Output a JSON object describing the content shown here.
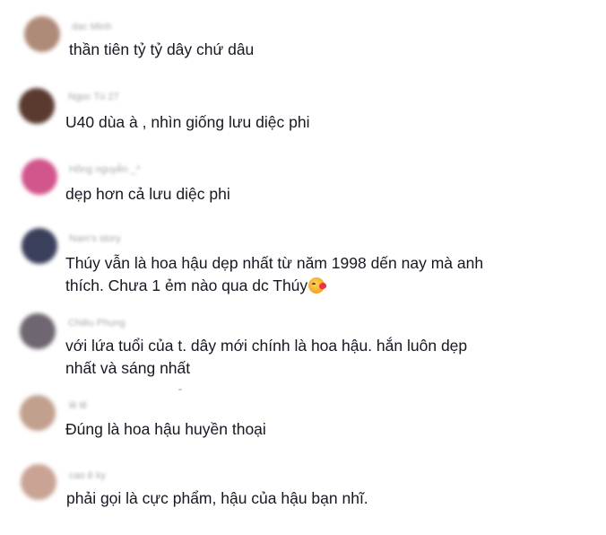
{
  "comments": [
    {
      "username": "dac Minh",
      "text": "thần tiên tỷ tỷ dây chứ dâu",
      "avatar_color": "#b08a78"
    },
    {
      "username": "Ngọc Tú 27",
      "text": "U40 dùa à , nhìn giống lưu diệc phi",
      "avatar_color": "#5a3a2e"
    },
    {
      "username": "Hồng nguyễn _^",
      "text": "dẹp hơn cả lưu diệc phi",
      "avatar_color": "#d2558c"
    },
    {
      "username": "Nam's story",
      "lines": [
        "Thúy vẫn là hoa hậu dẹp nhất từ năm 1998 dến nay mà anh",
        "thích. Chưa 1 ẻm nào qua dc Thúy"
      ],
      "emoji": "face-blowing-kiss-icon",
      "avatar_color": "#3a3f5c"
    },
    {
      "username": "Chiêu Phụng",
      "lines": [
        "với lứa tuổi của t. dây mới chính là hoa hậu. hắn luôn dẹp",
        "nhất và sáng nhất"
      ],
      "avatar_color": "#6e6670"
    },
    {
      "username": "lê lê",
      "text": "Đúng là hoa hậu huyền thoại",
      "avatar_color": "#c2a08e"
    },
    {
      "username": "cao ê ky",
      "text": "phải gọi là cực phẩm, hậu của hậu bạn nhĩ.",
      "avatar_color": "#c9a394"
    }
  ]
}
